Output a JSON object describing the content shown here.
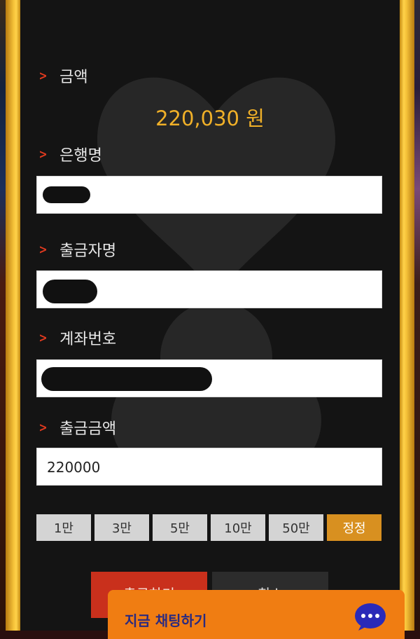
{
  "form": {
    "amount_label": "금액",
    "amount_value": "220,030 원",
    "bank_label": "은행명",
    "holder_label": "출금자명",
    "account_label": "계좌번호",
    "withdraw_amount_label": "출금금액",
    "withdraw_amount_value": "220000"
  },
  "quick_amounts": [
    "1만",
    "3만",
    "5만",
    "10만",
    "50만"
  ],
  "reset_label": "정정",
  "actions": {
    "withdraw_label": "출금하기",
    "cancel_label": "취소"
  },
  "chat": {
    "label": "지금 채팅하기"
  },
  "colors": {
    "accent_gold": "#f0b028",
    "frame_gold": "#ffd24a",
    "chevron_red": "#e03a1f",
    "chat_orange": "#f07d12",
    "withdraw_red": "#c9301c"
  }
}
